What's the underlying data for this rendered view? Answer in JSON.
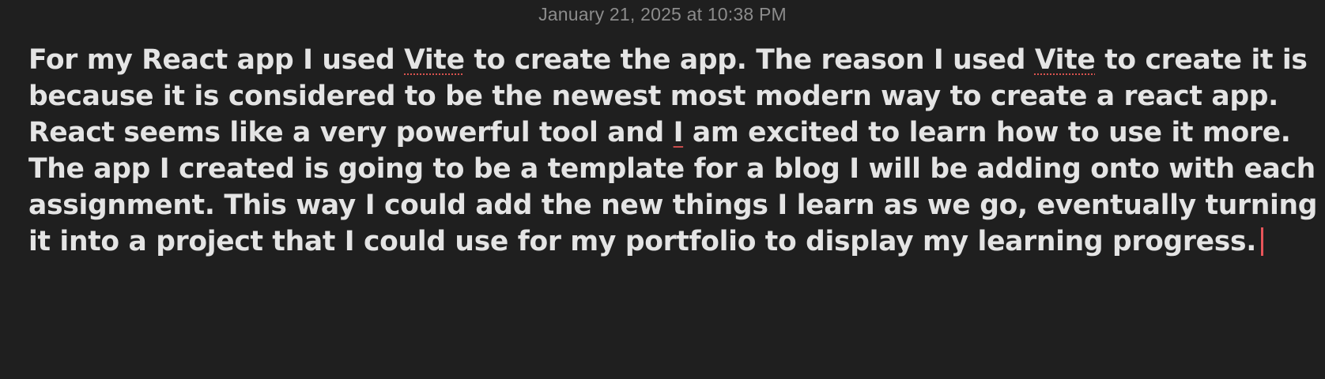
{
  "note": {
    "timestamp": "January 21, 2025 at 10:38 PM",
    "lines": [
      [
        "For my React app I used ",
        "Vite",
        " to create the app. The reason I used ",
        "Vite",
        " to create it is"
      ],
      [
        "because it is considered to be the newest most modern way to create a react app."
      ],
      [
        "React seems like a very powerful tool and ",
        "I",
        " am excited to learn how to use it more."
      ],
      [
        "The app I created is going to be a template for a blog I will be adding onto with each"
      ],
      [
        "assignment. This way I could add the new things I learn as we go, eventually turning"
      ],
      [
        "it into a project that I could use for my portfolio to display my learning progress."
      ]
    ]
  },
  "colors": {
    "background": "#1f1f1f",
    "text": "#e4e4e4",
    "timestamp": "#8c8c8c",
    "caret": "#e8555a",
    "spellcheck_underline": "#d9534f"
  }
}
